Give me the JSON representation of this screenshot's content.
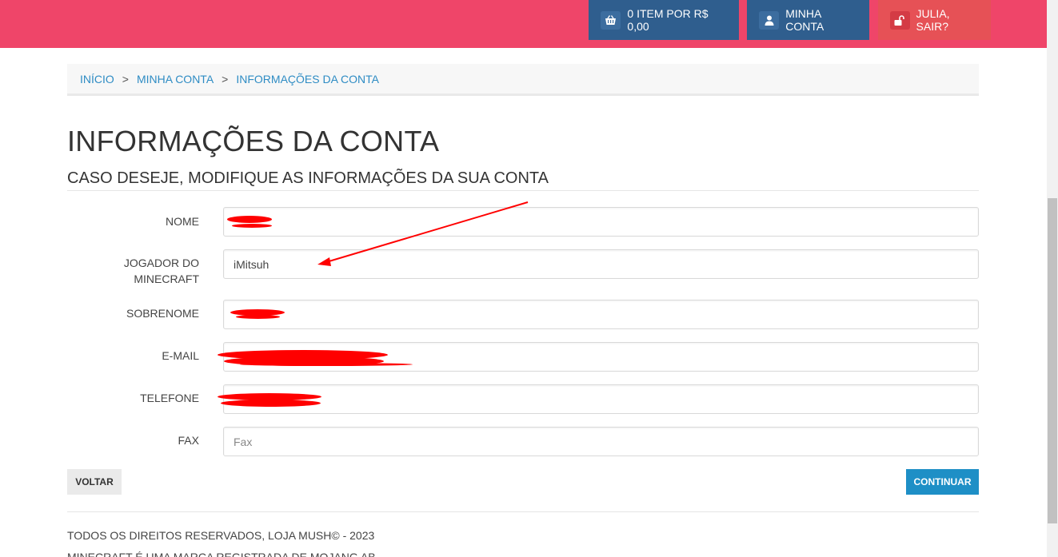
{
  "header": {
    "cart_label": "0 ITEM POR R$ 0,00",
    "account_label": "MINHA CONTA",
    "logout_label": "JULIA, SAIR?"
  },
  "breadcrumb": {
    "items": [
      "INÍCIO",
      "MINHA CONTA",
      "INFORMAÇÕES DA CONTA"
    ],
    "separator": ">"
  },
  "page": {
    "title": "INFORMAÇÕES DA CONTA",
    "subtitle": "CASO DESEJE, MODIFIQUE AS INFORMAÇÕES DA SUA CONTA"
  },
  "form": {
    "fields": [
      {
        "label": "NOME",
        "value": "",
        "placeholder": ""
      },
      {
        "label_line1": "JOGADOR DO",
        "label_line2": "MINECRAFT",
        "value": "iMitsuh",
        "placeholder": ""
      },
      {
        "label": "SOBRENOME",
        "value": "",
        "placeholder": ""
      },
      {
        "label": "E-MAIL",
        "value": "",
        "placeholder": ""
      },
      {
        "label": "TELEFONE",
        "value": "",
        "placeholder": ""
      },
      {
        "label": "FAX",
        "value": "",
        "placeholder": "Fax"
      }
    ],
    "back_label": "VOLTAR",
    "continue_label": "CONTINUAR"
  },
  "footer": {
    "copyright": "TODOS OS DIREITOS RESERVADOS, LOJA MUSH© - 2023",
    "second_line": "MINECRAFT É UMA MARCA REGISTRADA DE MOJANG AB"
  },
  "colors": {
    "topbar": "#ef4569",
    "nav_button": "#2f5e8e",
    "logout_button": "#e65156",
    "link": "#2e8cc4",
    "continue_button": "#1e8fc6",
    "annotation": "#ff0000"
  },
  "icons": {
    "cart": "basket-icon",
    "account": "user-icon",
    "logout": "unlock-icon"
  }
}
